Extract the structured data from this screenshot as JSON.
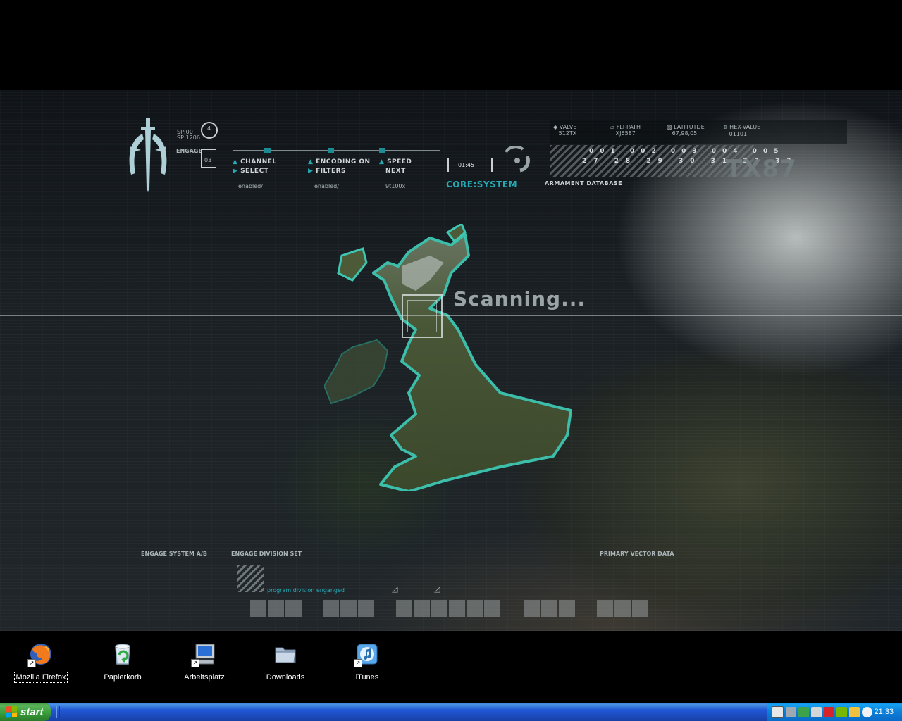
{
  "hud": {
    "sp_lines": [
      "SP:00",
      "SP:1206"
    ],
    "engage_label": "ENGAGE",
    "engage_value": "03",
    "dial_value": "4",
    "controls": [
      {
        "top": "CHANNEL",
        "bottom": "SELECT",
        "status": "enabled/"
      },
      {
        "top": "ENCODING ON",
        "bottom": "FILTERS",
        "status": "enabled/"
      },
      {
        "top": "SPEED",
        "bottom": "NEXT",
        "status": "9t100x"
      }
    ],
    "timer": "01:45",
    "core_system": "CORE:SYSTEM",
    "armament": "ARMAMENT DATABASE",
    "stats": [
      {
        "label": "VALVE",
        "value": "512TX"
      },
      {
        "label": "FLI-PATH",
        "value": "XJ6587"
      },
      {
        "label": "LATITUTDE",
        "value": "67,98,05"
      },
      {
        "label": "HEX-VALUE",
        "value": "01101"
      }
    ],
    "num_top": "001 002 003 004 005",
    "num_bottom": "27 28 29 30 31 32 33",
    "tx_code": "TX87",
    "scanning": "Scanning...",
    "engage_system": "ENGAGE SYSTEM A/B",
    "engage_division": "ENGAGE DIVISION SET",
    "primary_vector": "PRIMARY VECTOR DATA",
    "program_division": "program division enganged"
  },
  "desktop_icons": [
    {
      "label": "Mozilla Firefox",
      "icon": "firefox-icon"
    },
    {
      "label": "Papierkorb",
      "icon": "recycle-bin-icon"
    },
    {
      "label": "Arbeitsplatz",
      "icon": "my-computer-icon"
    },
    {
      "label": "Downloads",
      "icon": "folder-icon"
    },
    {
      "label": "iTunes",
      "icon": "itunes-icon"
    }
  ],
  "taskbar": {
    "start_label": "start",
    "clock": "21:33",
    "tray_icons": [
      "antivirus-icon",
      "network-icon",
      "volume-icon",
      "avira-icon",
      "nvidia-icon",
      "update-icon",
      "safely-remove-icon"
    ]
  },
  "colors": {
    "accent_teal": "#25a9b4",
    "taskbar_blue": "#2157d7",
    "start_green": "#379a37",
    "tray_blue": "#0c7fd9"
  }
}
